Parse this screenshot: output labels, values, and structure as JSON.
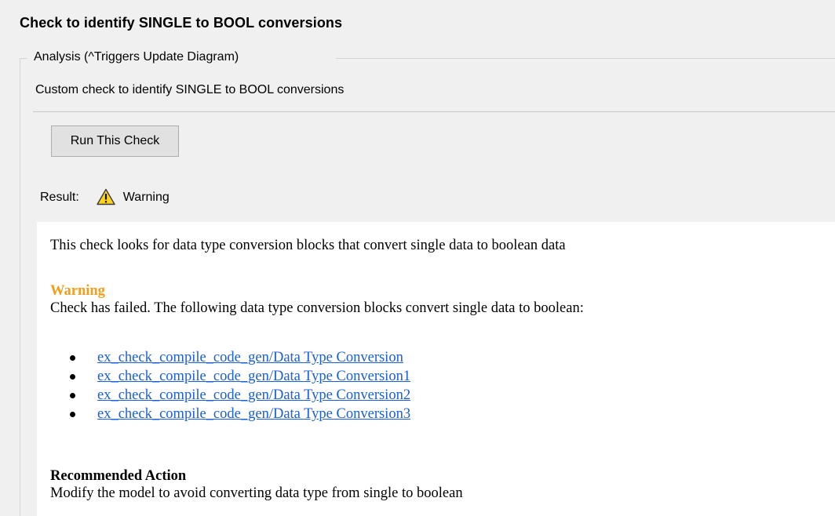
{
  "check": {
    "title": "Check to identify SINGLE to BOOL conversions",
    "group_label": "Analysis (^Triggers Update Diagram)",
    "description": "Custom check to identify SINGLE to BOOL conversions",
    "run_button_label": "Run This Check",
    "result_label": "Result:",
    "result_status": "Warning",
    "result_icon": "warning-triangle-icon"
  },
  "report": {
    "intro": "This check looks for data type conversion blocks that convert single data to boolean data",
    "warning_heading": "Warning",
    "warning_heading_color": "#f19e1e",
    "warning_text": "Check has failed. The following data type conversion blocks convert single data to boolean:",
    "blocks": [
      "ex_check_compile_code_gen/Data Type Conversion",
      "ex_check_compile_code_gen/Data Type Conversion1",
      "ex_check_compile_code_gen/Data Type Conversion2",
      "ex_check_compile_code_gen/Data Type Conversion3"
    ],
    "recommended_heading": "Recommended Action",
    "recommended_text": "Modify the model to avoid converting data type from single to boolean"
  }
}
